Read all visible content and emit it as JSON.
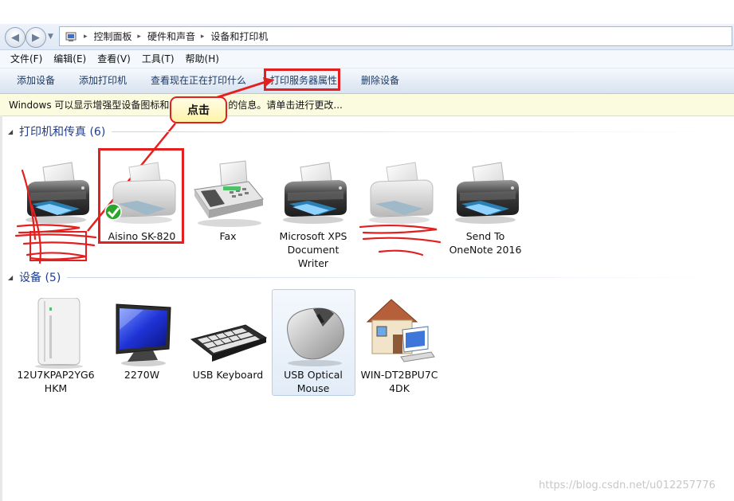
{
  "breadcrumb": {
    "items": [
      {
        "label": "控制面板"
      },
      {
        "label": "硬件和声音"
      },
      {
        "label": "设备和打印机"
      }
    ]
  },
  "menu": {
    "items": [
      {
        "label": "文件(F)"
      },
      {
        "label": "编辑(E)"
      },
      {
        "label": "查看(V)"
      },
      {
        "label": "工具(T)"
      },
      {
        "label": "帮助(H)"
      }
    ]
  },
  "toolbar": {
    "items": [
      {
        "label": "添加设备"
      },
      {
        "label": "添加打印机"
      },
      {
        "label": "查看现在正在打印什么"
      },
      {
        "label": "打印服务器属性"
      },
      {
        "label": "删除设备"
      }
    ]
  },
  "infobar": {
    "text_before": "Windows 可以显示增强型设备图标和",
    "text_after": "的信息。请单击进行更改..."
  },
  "annotation": {
    "callout": "点击",
    "accent_color": "#e32020"
  },
  "groups": {
    "printers": {
      "title": "打印机和传真 (6)",
      "items": [
        {
          "name": "",
          "icon": "printer-icon",
          "redacted": true
        },
        {
          "name": "Aisino SK-820",
          "icon": "printer-default-icon"
        },
        {
          "name": "Fax",
          "icon": "fax-icon"
        },
        {
          "name": "Microsoft XPS Document Writer",
          "icon": "printer-icon"
        },
        {
          "name": "",
          "icon": "printer-icon",
          "redacted": true
        },
        {
          "name": "Send To OneNote 2016",
          "icon": "printer-icon"
        }
      ]
    },
    "devices": {
      "title": "设备 (5)",
      "items": [
        {
          "name": "12U7KPAP2YG6 HKM",
          "icon": "computer-tower-icon"
        },
        {
          "name": "2270W",
          "icon": "monitor-icon"
        },
        {
          "name": "USB Keyboard",
          "icon": "keyboard-icon"
        },
        {
          "name": "USB Optical Mouse",
          "icon": "mouse-icon"
        },
        {
          "name": "WIN-DT2BPU7C 4DK",
          "icon": "home-network-icon"
        }
      ]
    }
  },
  "watermark": "https://blog.csdn.net/u012257776"
}
